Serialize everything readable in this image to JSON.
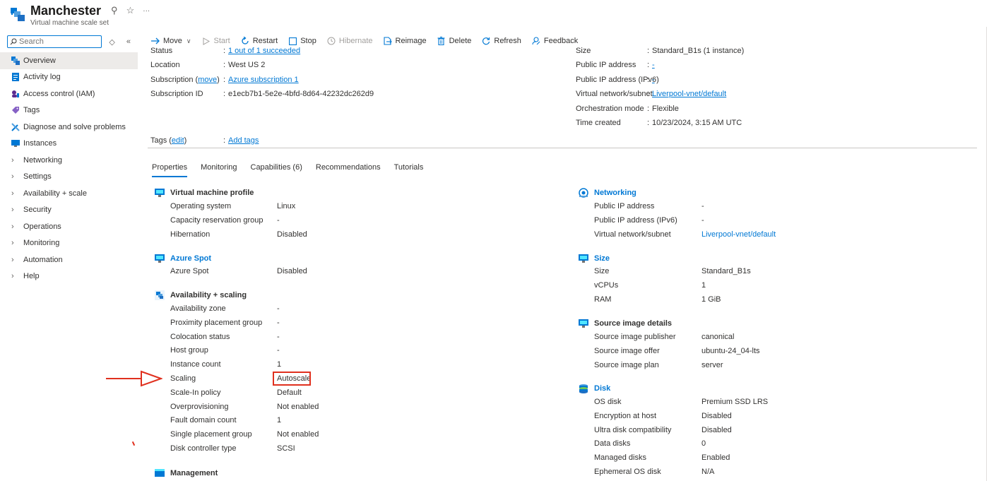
{
  "header": {
    "title": "Manchester",
    "subtitle": "Virtual machine scale set",
    "pin_glyph": "⚲",
    "star_glyph": "☆",
    "more_glyph": "···"
  },
  "sidebar": {
    "search_placeholder": "Search",
    "items": [
      {
        "label": "Overview",
        "icon": "overview-icon",
        "expandable": false,
        "active": true
      },
      {
        "label": "Activity log",
        "icon": "activity-log-icon",
        "expandable": false
      },
      {
        "label": "Access control (IAM)",
        "icon": "iam-icon",
        "expandable": false
      },
      {
        "label": "Tags",
        "icon": "tag-icon",
        "expandable": false
      },
      {
        "label": "Diagnose and solve problems",
        "icon": "wrench-icon",
        "expandable": false
      },
      {
        "label": "Instances",
        "icon": "monitor-icon",
        "expandable": false
      },
      {
        "label": "Networking",
        "expandable": true
      },
      {
        "label": "Settings",
        "expandable": true
      },
      {
        "label": "Availability + scale",
        "expandable": true
      },
      {
        "label": "Security",
        "expandable": true
      },
      {
        "label": "Operations",
        "expandable": true
      },
      {
        "label": "Monitoring",
        "expandable": true
      },
      {
        "label": "Automation",
        "expandable": true
      },
      {
        "label": "Help",
        "expandable": true
      }
    ]
  },
  "toolbar": {
    "move": "Move",
    "start": "Start",
    "restart": "Restart",
    "stop": "Stop",
    "hibernate": "Hibernate",
    "reimage": "Reimage",
    "delete": "Delete",
    "refresh": "Refresh",
    "feedback": "Feedback"
  },
  "essentials": {
    "left": {
      "status_label": "Status",
      "status_value": "1 out of 1 succeeded",
      "location_label": "Location",
      "location_value": "West US 2",
      "subscription_label": "Subscription",
      "subscription_move": "move",
      "subscription_value": "Azure subscription 1",
      "subscription_id_label": "Subscription ID",
      "subscription_id_value": "e1ecb7b1-5e2e-4bfd-8d64-42232dc262d9",
      "tags_label": "Tags",
      "tags_edit": "edit",
      "tags_value": "Add tags"
    },
    "right": {
      "size_label": "Size",
      "size_value": "Standard_B1s (1 instance)",
      "public_ip_label": "Public IP address",
      "public_ip_value": "-",
      "public_ipv6_label": "Public IP address (IPv6)",
      "public_ipv6_value": "-",
      "vnet_label": "Virtual network/subnet",
      "vnet_value": "Liverpool-vnet/default",
      "orch_label": "Orchestration mode",
      "orch_value": "Flexible",
      "time_label": "Time created",
      "time_value": "10/23/2024, 3:15 AM UTC"
    }
  },
  "tabs": [
    "Properties",
    "Monitoring",
    "Capabilities (6)",
    "Recommendations",
    "Tutorials"
  ],
  "properties": {
    "vm_profile": {
      "title": "Virtual machine profile",
      "rows": [
        [
          "Operating system",
          "Linux"
        ],
        [
          "Capacity reservation group",
          "-"
        ],
        [
          "Hibernation",
          "Disabled"
        ]
      ]
    },
    "azure_spot": {
      "title": "Azure Spot",
      "rows": [
        [
          "Azure Spot",
          "Disabled"
        ]
      ]
    },
    "availability": {
      "title": "Availability + scaling",
      "rows": [
        [
          "Availability zone",
          "-"
        ],
        [
          "Proximity placement group",
          "-"
        ],
        [
          "Colocation status",
          "-"
        ],
        [
          "Host group",
          "-"
        ],
        [
          "Instance count",
          "1"
        ],
        [
          "Scaling",
          "Autoscale"
        ],
        [
          "Scale-In policy",
          "Default"
        ],
        [
          "Overprovisioning",
          "Not enabled"
        ],
        [
          "Fault domain count",
          "1"
        ],
        [
          "Single placement group",
          "Not enabled"
        ],
        [
          "Disk controller type",
          "SCSI"
        ]
      ]
    },
    "management": {
      "title": "Management"
    },
    "networking": {
      "title": "Networking",
      "rows": [
        [
          "Public IP address",
          "-"
        ],
        [
          "Public IP address (IPv6)",
          "-"
        ],
        [
          "Virtual network/subnet",
          "Liverpool-vnet/default"
        ]
      ]
    },
    "size": {
      "title": "Size",
      "rows": [
        [
          "Size",
          "Standard_B1s"
        ],
        [
          "vCPUs",
          "1"
        ],
        [
          "RAM",
          "1 GiB"
        ]
      ]
    },
    "source_image": {
      "title": "Source image details",
      "rows": [
        [
          "Source image publisher",
          "canonical"
        ],
        [
          "Source image offer",
          "ubuntu-24_04-lts"
        ],
        [
          "Source image plan",
          "server"
        ]
      ]
    },
    "disk": {
      "title": "Disk",
      "rows": [
        [
          "OS disk",
          "Premium SSD LRS"
        ],
        [
          "Encryption at host",
          "Disabled"
        ],
        [
          "Ultra disk compatibility",
          "Disabled"
        ],
        [
          "Data disks",
          "0"
        ],
        [
          "Managed disks",
          "Enabled"
        ],
        [
          "Ephemeral OS disk",
          "N/A"
        ]
      ]
    }
  },
  "colors": {
    "accent": "#0078d4",
    "annotation": "#e0301e"
  }
}
